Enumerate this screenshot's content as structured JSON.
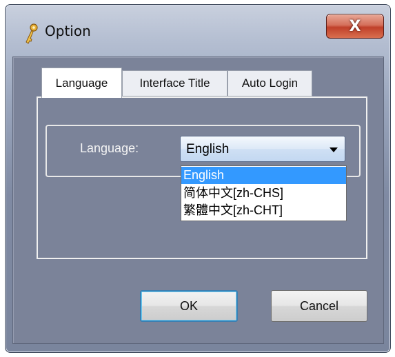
{
  "window": {
    "title": "Option",
    "close_label": "X"
  },
  "tabs": [
    {
      "label": "Language",
      "active": true
    },
    {
      "label": "Interface Title",
      "active": false
    },
    {
      "label": "Auto Login",
      "active": false
    }
  ],
  "language_panel": {
    "label": "Language:",
    "selected_value": "English",
    "options": [
      "English",
      "简体中文[zh-CHS]",
      "繁體中文[zh-CHT]"
    ],
    "highlighted_index": 0
  },
  "buttons": {
    "ok_label": "OK",
    "cancel_label": "Cancel"
  },
  "colors": {
    "selection": "#3399ff",
    "dialog_body": "#7b8399",
    "close_button": "#c0402a"
  }
}
